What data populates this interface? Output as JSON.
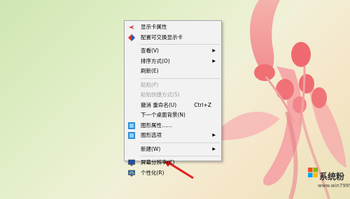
{
  "menu": {
    "items": [
      {
        "label": "显示卡属性",
        "icon": "graphics-properties-icon"
      },
      {
        "label": "配置可交换显示卡",
        "icon": "switchable-graphics-icon"
      },
      {
        "label": "查看(V)",
        "submenu": true
      },
      {
        "label": "排序方式(O)",
        "submenu": true
      },
      {
        "label": "刷新(E)"
      },
      {
        "label": "粘贴(P)",
        "disabled": true
      },
      {
        "label": "粘贴快捷方式(S)",
        "disabled": true
      },
      {
        "label": "撤消 重命名(U)",
        "shortcut": "Ctrl+Z"
      },
      {
        "label": "下一个桌面背景(N)"
      },
      {
        "label": "图形属性……",
        "icon": "intel-graphics-icon"
      },
      {
        "label": "图形选项",
        "icon": "intel-graphics-icon",
        "submenu": true
      },
      {
        "label": "新建(W)",
        "submenu": true
      },
      {
        "label": "屏幕分辨率(C)",
        "icon": "screen-resolution-icon"
      },
      {
        "label": "个性化(R)",
        "icon": "personalize-icon"
      }
    ]
  },
  "watermark": {
    "brand": "系统粉",
    "url": "www.win7999.com",
    "logo_colors": [
      "#f25022",
      "#7fba00",
      "#00a4ef",
      "#ffb900"
    ]
  }
}
